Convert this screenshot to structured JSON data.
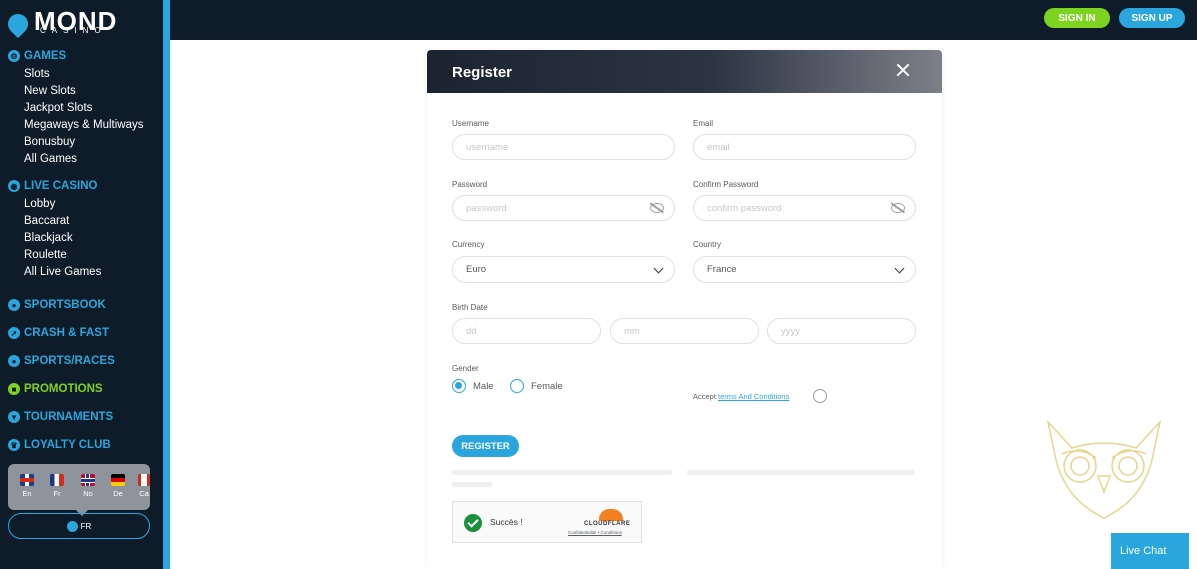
{
  "brand": {
    "name": "MOND",
    "sub": "CASINO"
  },
  "sidebar": {
    "sections": [
      {
        "label": "GAMES",
        "icon": "games-icon",
        "items": [
          "Slots",
          "New Slots",
          "Jackpot Slots",
          "Megaways & Multiways",
          "Bonusbuy",
          "All Games"
        ]
      },
      {
        "label": "LIVE CASINO",
        "icon": "live-casino-icon",
        "items": [
          "Lobby",
          "Baccarat",
          "Blackjack",
          "Roulette",
          "All Live Games"
        ]
      },
      {
        "label": "SPORTSBOOK",
        "icon": "sportsbook-icon",
        "items": []
      },
      {
        "label": "CRASH & FAST",
        "icon": "crash-icon",
        "items": []
      },
      {
        "label": "SPORTS/RACES",
        "icon": "sports-races-icon",
        "items": []
      },
      {
        "label": "PROMOTIONS",
        "icon": "gift-icon",
        "items": []
      },
      {
        "label": "TOURNAMENTS",
        "icon": "trophy-icon",
        "items": []
      },
      {
        "label": "LOYALTY CLUB",
        "icon": "crown-icon",
        "items": []
      }
    ],
    "languages": [
      {
        "code": "En",
        "icon": "uk-flag-icon"
      },
      {
        "code": "Fr",
        "icon": "france-flag-icon"
      },
      {
        "code": "No",
        "icon": "norway-flag-icon"
      },
      {
        "code": "De",
        "icon": "germany-flag-icon"
      },
      {
        "code": "Ca",
        "icon": "canada-flag-icon"
      }
    ],
    "current_language": "FR"
  },
  "header": {
    "signin_label": "SIGN IN",
    "signup_label": "SIGN UP"
  },
  "modal": {
    "title": "Register",
    "username": {
      "label": "Username",
      "placeholder": "username"
    },
    "email": {
      "label": "Email",
      "placeholder": "email"
    },
    "password": {
      "label": "Password",
      "placeholder": "password"
    },
    "confirm_password": {
      "label": "Confirm Password",
      "placeholder": "confirm password"
    },
    "currency": {
      "label": "Currency",
      "value": "Euro"
    },
    "country": {
      "label": "Country",
      "value": "France"
    },
    "birth_date": {
      "label": "Birth Date",
      "dd": "dd",
      "mm": "mm",
      "yyyy": "yyyy"
    },
    "gender": {
      "label": "Gender",
      "male": "Male",
      "female": "Female",
      "selected": "Male"
    },
    "accept": {
      "prefix": "Accept",
      "link": "terms And Conditions"
    },
    "register_label": "REGISTER",
    "captcha": {
      "status": "Succès !",
      "provider": "CLOUDFLARE",
      "links": "Confidentialité • Conditions"
    }
  },
  "livechat_label": "Live Chat",
  "colors": {
    "accent": "#2aa6dc",
    "green": "#7ed321",
    "dark": "#0e1c2a"
  }
}
